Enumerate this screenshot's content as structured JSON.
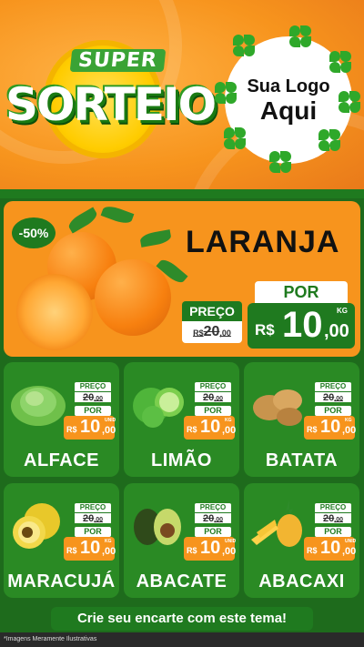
{
  "header": {
    "title_small": "SUPER",
    "title_big": "SORTEIO",
    "logo_line1": "Sua Logo",
    "logo_line2": "Aqui"
  },
  "colors": {
    "green": "#1f7a1f",
    "orange": "#f7941d",
    "card_green": "#2a8a24"
  },
  "hero": {
    "discount": "-50%",
    "product": "LARANJA",
    "old_label": "PREÇO",
    "old_currency": "R$",
    "old_int": "20",
    "old_dec": ",00",
    "new_label": "POR",
    "new_currency": "R$",
    "new_int": "10",
    "new_dec": ",00",
    "unit": "KG"
  },
  "products": [
    {
      "name": "ALFACE",
      "icon": "lettuce-icon",
      "old_label": "PREÇO",
      "old_price": "20",
      "old_dec": ",00",
      "por": "POR",
      "currency": "R$",
      "int": "10",
      "dec": ",00",
      "unit": "UNID"
    },
    {
      "name": "LIMÃO",
      "icon": "lime-icon",
      "old_label": "PREÇO",
      "old_price": "20",
      "old_dec": ",00",
      "por": "POR",
      "currency": "R$",
      "int": "10",
      "dec": ",00",
      "unit": "KG"
    },
    {
      "name": "BATATA",
      "icon": "potato-icon",
      "old_label": "PREÇO",
      "old_price": "20",
      "old_dec": ",00",
      "por": "POR",
      "currency": "R$",
      "int": "10",
      "dec": ",00",
      "unit": "KG"
    },
    {
      "name": "MARACUJÁ",
      "icon": "passion-fruit-icon",
      "old_label": "PREÇO",
      "old_price": "20",
      "old_dec": ",00",
      "por": "POR",
      "currency": "R$",
      "int": "10",
      "dec": ",00",
      "unit": "KG"
    },
    {
      "name": "ABACATE",
      "icon": "avocado-icon",
      "old_label": "PREÇO",
      "old_price": "20",
      "old_dec": ",00",
      "por": "POR",
      "currency": "R$",
      "int": "10",
      "dec": ",00",
      "unit": "UNID"
    },
    {
      "name": "ABACAXI",
      "icon": "pineapple-icon",
      "old_label": "PREÇO",
      "old_price": "20",
      "old_dec": ",00",
      "por": "POR",
      "currency": "R$",
      "int": "10",
      "dec": ",00",
      "unit": "UNID"
    }
  ],
  "footer": {
    "banner": "Crie seu encarte com este tema!",
    "note": "*Imagens Meramente Ilustrativas"
  }
}
